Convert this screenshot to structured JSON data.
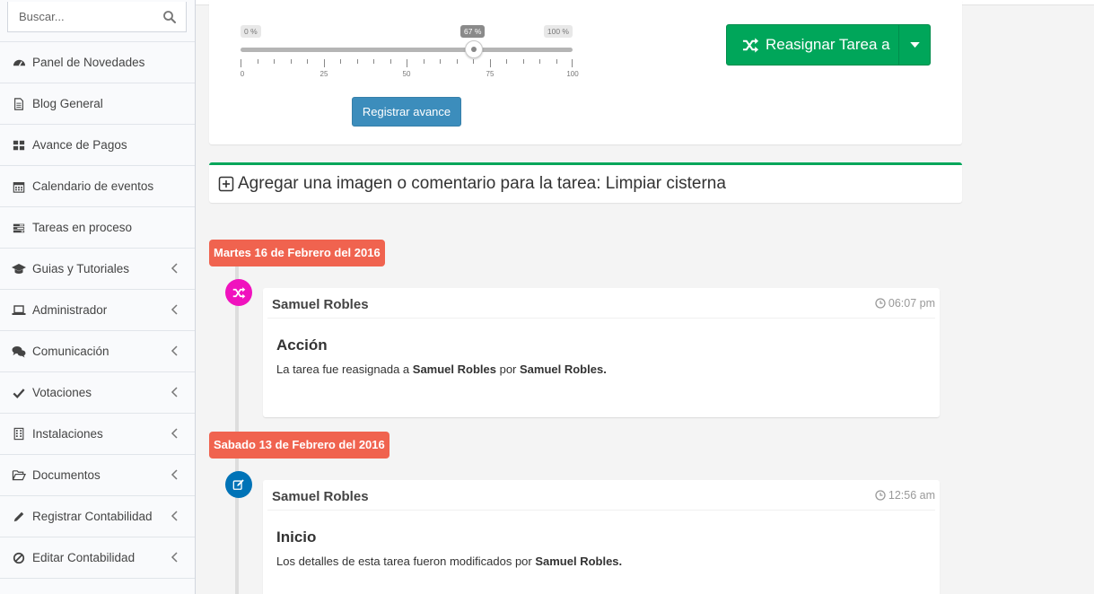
{
  "search": {
    "placeholder": "Buscar..."
  },
  "sidebar": {
    "items": [
      {
        "label": "Panel de Novedades",
        "icon": "dashboard-icon",
        "has_submenu": false
      },
      {
        "label": "Blog General",
        "icon": "file-icon",
        "has_submenu": false
      },
      {
        "label": "Avance de Pagos",
        "icon": "grid-icon",
        "has_submenu": false
      },
      {
        "label": "Calendario de eventos",
        "icon": "calendar-icon",
        "has_submenu": false
      },
      {
        "label": "Tareas en proceso",
        "icon": "tasks-icon",
        "has_submenu": false
      },
      {
        "label": "Guias y Tutoriales",
        "icon": "graduation-cap-icon",
        "has_submenu": true
      },
      {
        "label": "Administrador",
        "icon": "laptop-icon",
        "has_submenu": true
      },
      {
        "label": "Comunicación",
        "icon": "comments-icon",
        "has_submenu": true
      },
      {
        "label": "Votaciones",
        "icon": "check-icon",
        "has_submenu": true
      },
      {
        "label": "Instalaciones",
        "icon": "building-icon",
        "has_submenu": true
      },
      {
        "label": "Documentos",
        "icon": "folder-open-icon",
        "has_submenu": true
      },
      {
        "label": "Registrar Contabilidad",
        "icon": "pencil-icon",
        "has_submenu": true
      },
      {
        "label": "Editar Contabilidad",
        "icon": "ban-icon",
        "has_submenu": true
      }
    ]
  },
  "progress": {
    "min_label": "0 %",
    "max_label": "100 %",
    "current_label": "67 %",
    "value": 67,
    "tick_labels": [
      "0",
      "25",
      "50",
      "75",
      "100"
    ],
    "register_button": "Registrar avance"
  },
  "reassign": {
    "label": "Reasignar Tarea a",
    "icon": "random-icon"
  },
  "add_comment": {
    "label": "Agregar una imagen o comentario para la tarea: Limpiar cisterna",
    "icon": "plus-square-icon"
  },
  "timeline": {
    "entries": [
      {
        "date": "Martes 16 de Febrero del 2016",
        "icon": "random-icon",
        "icon_color": "#f012be",
        "author": "Samuel Robles",
        "time": "06:07 pm",
        "title": "Acción",
        "body_parts": [
          "La tarea fue reasignada a ",
          "Samuel Robles",
          " por ",
          "Samuel Robles."
        ]
      },
      {
        "date": "Sabado 13 de Febrero del 2016",
        "icon": "edit-icon",
        "icon_color": "#0073b7",
        "author": "Samuel Robles",
        "time": "12:56 am",
        "title": "Inicio",
        "body_parts": [
          "Los detalles de esta tarea fueron modificados por ",
          "Samuel Robles."
        ]
      }
    ]
  },
  "colors": {
    "green": "#00a65a",
    "blue": "#3c8dbc",
    "date_badge": "#f0634f"
  }
}
